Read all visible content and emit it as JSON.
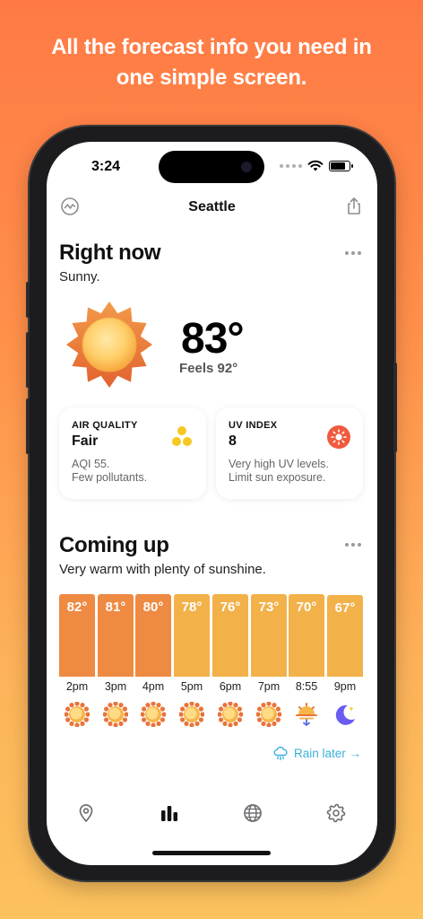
{
  "tagline": {
    "line1": "All the forecast info you need in",
    "line2": "one simple screen."
  },
  "status_bar": {
    "time": "3:24"
  },
  "nav": {
    "city": "Seattle"
  },
  "right_now": {
    "title": "Right now",
    "condition": "Sunny.",
    "temperature": "83°",
    "feels_like": "Feels 92°"
  },
  "air_quality": {
    "label": "AIR QUALITY",
    "value": "Fair",
    "desc_line1": "AQI 55.",
    "desc_line2": "Few pollutants.",
    "icon": "three-dots-icon",
    "color": "#f6c823"
  },
  "uv_index": {
    "label": "UV INDEX",
    "value": "8",
    "desc_line1": "Very high UV levels.",
    "desc_line2": "Limit sun exposure.",
    "icon": "sun-icon",
    "color": "#f05a3e"
  },
  "coming_up": {
    "title": "Coming up",
    "subtitle": "Very warm with plenty of sunshine.",
    "rain_later": "Rain later →"
  },
  "chart_data": {
    "type": "bar",
    "categories": [
      "2pm",
      "3pm",
      "4pm",
      "5pm",
      "6pm",
      "7pm",
      "8:55",
      "9pm"
    ],
    "values": [
      82,
      81,
      80,
      78,
      76,
      73,
      70,
      67
    ],
    "labels": [
      "82°",
      "81°",
      "80°",
      "78°",
      "76°",
      "73°",
      "70°",
      "67°"
    ],
    "icons": [
      "sun-icon",
      "sun-icon",
      "sun-icon",
      "sun-icon",
      "sun-icon",
      "sun-icon",
      "sunset-icon",
      "moon-icon"
    ],
    "colors": [
      "#ee8a42",
      "#ee8a42",
      "#ee8a42",
      "#f3b14a",
      "#f3b14a",
      "#f3b14a",
      "#f3b14a",
      "#f3b14a"
    ]
  },
  "tabs": [
    {
      "icon": "location-icon"
    },
    {
      "icon": "chart-bars-icon"
    },
    {
      "icon": "globe-icon"
    },
    {
      "icon": "gear-icon"
    }
  ]
}
